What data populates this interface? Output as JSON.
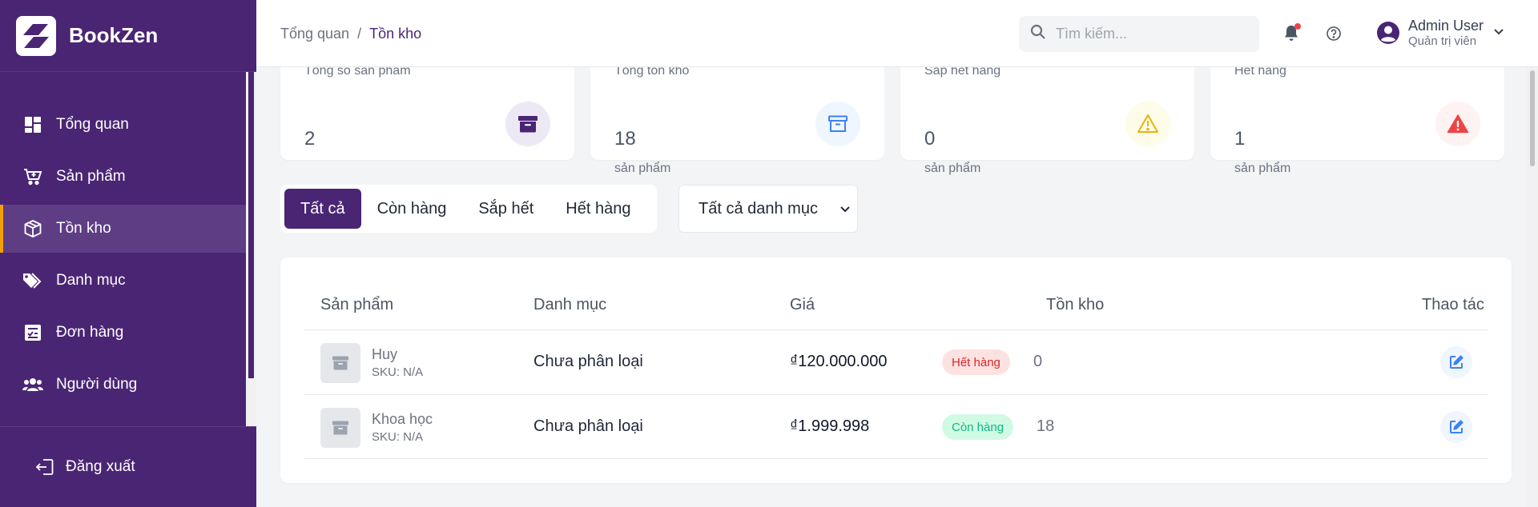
{
  "brand": {
    "name": "BookZen"
  },
  "sidebar": {
    "items": [
      {
        "label": "Tổng quan",
        "icon": "dashboard-icon"
      },
      {
        "label": "Sản phẩm",
        "icon": "cart-icon"
      },
      {
        "label": "Tồn kho",
        "icon": "box-icon",
        "active": true
      },
      {
        "label": "Danh mục",
        "icon": "tags-icon"
      },
      {
        "label": "Đơn hàng",
        "icon": "order-list-icon"
      },
      {
        "label": "Người dùng",
        "icon": "users-icon"
      }
    ],
    "logout_label": "Đăng xuất"
  },
  "header": {
    "breadcrumb": {
      "root": "Tổng quan",
      "separator": "/",
      "current": "Tồn kho"
    },
    "search_placeholder": "Tìm kiếm...",
    "user": {
      "name": "Admin User",
      "role": "Quản trị viên"
    }
  },
  "stats": [
    {
      "label": "Tổng số sản phẩm",
      "value": "2",
      "unit": "",
      "icon": "archive-icon",
      "icon_color": "#4a2574",
      "icon_bg": "#ede9f4"
    },
    {
      "label": "Tổng tồn kho",
      "value": "18",
      "unit": "sản phẩm",
      "icon": "archive-outline-icon",
      "icon_color": "#3b82f6",
      "icon_bg": "#eff6ff"
    },
    {
      "label": "Sắp hết hàng",
      "value": "0",
      "unit": "sản phẩm",
      "icon": "warning-outline-icon",
      "icon_color": "#eab308",
      "icon_bg": "#fefce8"
    },
    {
      "label": "Hết hàng",
      "value": "1",
      "unit": "sản phẩm",
      "icon": "warning-solid-icon",
      "icon_color": "#ef4444",
      "icon_bg": "#fef2f2"
    }
  ],
  "filters": {
    "tabs": [
      "Tất cả",
      "Còn hàng",
      "Sắp hết",
      "Hết hàng"
    ],
    "active_tab": "Tất cả",
    "category_select": "Tất cả danh mục"
  },
  "table": {
    "headers": [
      "Sản phẩm",
      "Danh mục",
      "Giá",
      "Tồn kho",
      "Thao tác"
    ],
    "rows": [
      {
        "name": "Huy",
        "sku": "SKU: N/A",
        "category": "Chưa phân loại",
        "price": "₫120.000.000",
        "status": "Hết hàng",
        "status_type": "out",
        "qty": "0"
      },
      {
        "name": "Khoa học",
        "sku": "SKU: N/A",
        "category": "Chưa phân loại",
        "price": "₫1.999.998",
        "status": "Còn hàng",
        "status_type": "in",
        "qty": "18"
      }
    ]
  },
  "colors": {
    "primary": "#4a2574",
    "accent": "#f59e0b"
  }
}
